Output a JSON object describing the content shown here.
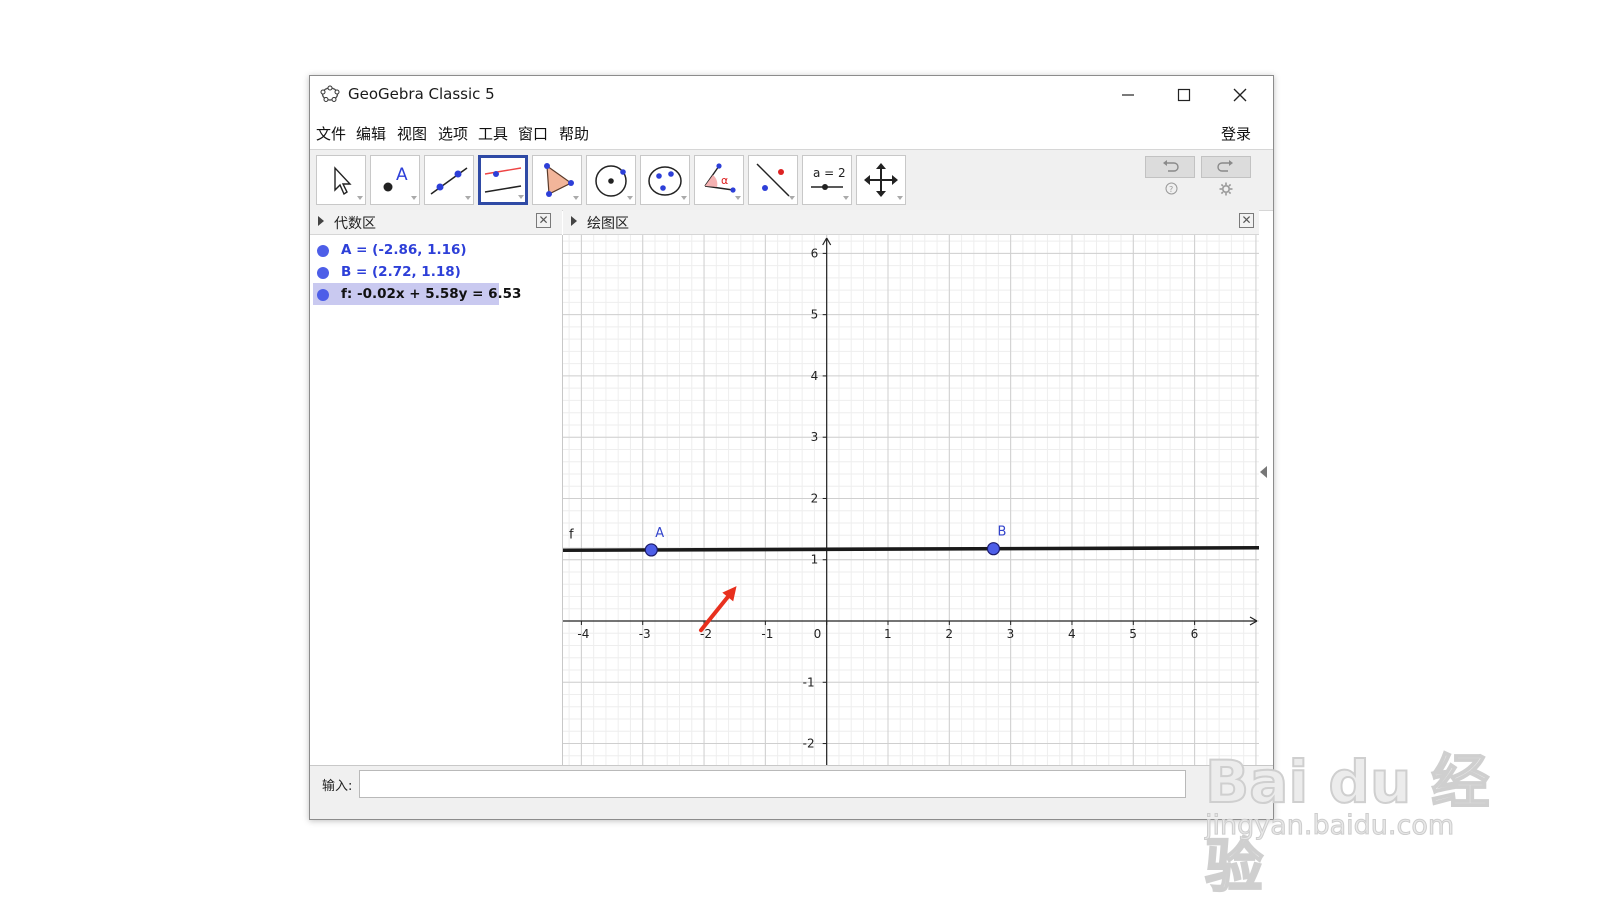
{
  "window": {
    "title": "GeoGebra Classic 5",
    "minimize_icon": "minimize-icon",
    "maximize_icon": "maximize-icon",
    "close_icon": "close-icon"
  },
  "menu": {
    "items": [
      "文件",
      "编辑",
      "视图",
      "选项",
      "工具",
      "窗口",
      "帮助"
    ],
    "login": "登录"
  },
  "toolbar": {
    "tools": [
      {
        "name": "move-tool",
        "icon": "arrow-cursor-icon"
      },
      {
        "name": "point-tool",
        "icon": "point-icon",
        "label": "A"
      },
      {
        "name": "line-tool",
        "icon": "line-through-two-points-icon"
      },
      {
        "name": "parallel-line-tool",
        "icon": "parallel-lines-icon",
        "selected": true
      },
      {
        "name": "polygon-tool",
        "icon": "polygon-icon"
      },
      {
        "name": "circle-tool",
        "icon": "circle-center-point-icon"
      },
      {
        "name": "conic-tool",
        "icon": "ellipse-icon"
      },
      {
        "name": "angle-tool",
        "icon": "angle-icon",
        "label": "α"
      },
      {
        "name": "reflect-tool",
        "icon": "reflect-icon"
      },
      {
        "name": "slider-tool",
        "icon": "slider-icon",
        "label": "a = 2"
      },
      {
        "name": "move-view-tool",
        "icon": "move-graphics-view-icon"
      }
    ],
    "undo_icon": "undo-icon",
    "redo_icon": "redo-icon",
    "help_icon": "help-icon",
    "settings_icon": "gear-icon",
    "accent": "#2f4aa5"
  },
  "algebra_view": {
    "title": "代数区",
    "items": [
      {
        "text": "A = (-2.86, 1.16)",
        "color": "#2d3fd8",
        "highlighted": false
      },
      {
        "text": "B = (2.72, 1.18)",
        "color": "#2d3fd8",
        "highlighted": false
      },
      {
        "text": "f: -0.02x + 5.58y = 6.53",
        "color": "#111111",
        "highlighted": true
      }
    ]
  },
  "graphics_view": {
    "title": "绘图区",
    "x_ticks": [
      -4,
      -3,
      -2,
      -1,
      0,
      1,
      2,
      3,
      4,
      5,
      6
    ],
    "y_ticks": [
      -2,
      -1,
      1,
      2,
      3,
      4,
      5,
      6
    ],
    "x_range": [
      -4.3,
      7.05
    ],
    "y_range": [
      -2.35,
      6.3
    ],
    "line_label": "f",
    "line_equation": {
      "a": -0.02,
      "b": 5.58,
      "c": 6.53
    },
    "points": [
      {
        "label": "A",
        "x": -2.86,
        "y": 1.16
      },
      {
        "label": "B",
        "x": 2.72,
        "y": 1.18
      }
    ],
    "point_color": "#4d5ee8",
    "annotation_arrow_color": "#e8301e",
    "annotation_arrow": {
      "from": [
        -2.05,
        -0.15
      ],
      "to": [
        -1.47,
        0.57
      ]
    }
  },
  "input_bar": {
    "label": "输入:",
    "value": ""
  },
  "watermark": {
    "brand": "Bai du 经验",
    "url": "jingyan.baidu.com"
  }
}
